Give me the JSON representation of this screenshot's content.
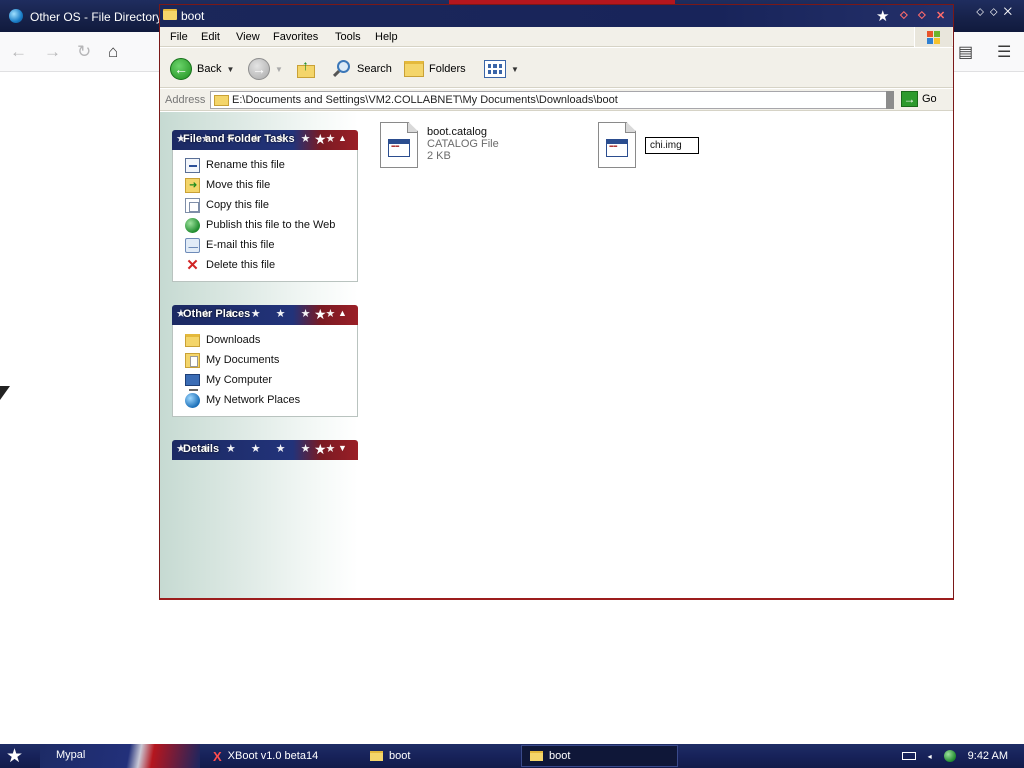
{
  "browser": {
    "title": "Other OS - File Directory"
  },
  "explorer": {
    "title": "boot",
    "menu": [
      "File",
      "Edit",
      "View",
      "Favorites",
      "Tools",
      "Help"
    ],
    "toolbar": {
      "back_label": "Back",
      "search_label": "Search",
      "folders_label": "Folders"
    },
    "address": {
      "label": "Address",
      "path": "E:\\Documents and Settings\\VM2.COLLABNET\\My Documents\\Downloads\\boot",
      "go_label": "Go"
    },
    "panels": {
      "file_tasks": {
        "title": "File and Folder Tasks",
        "items": [
          {
            "label": "Rename this file",
            "icon": "rename-icon"
          },
          {
            "label": "Move this file",
            "icon": "move-icon"
          },
          {
            "label": "Copy this file",
            "icon": "copy-icon"
          },
          {
            "label": "Publish this file to the Web",
            "icon": "publish-web-icon"
          },
          {
            "label": "E-mail this file",
            "icon": "email-icon"
          },
          {
            "label": "Delete this file",
            "icon": "delete-icon"
          }
        ]
      },
      "other_places": {
        "title": "Other Places",
        "items": [
          {
            "label": "Downloads",
            "icon": "folder-icon"
          },
          {
            "label": "My Documents",
            "icon": "my-documents-icon"
          },
          {
            "label": "My Computer",
            "icon": "my-computer-icon"
          },
          {
            "label": "My Network Places",
            "icon": "network-places-icon"
          }
        ]
      },
      "details": {
        "title": "Details"
      }
    },
    "files": [
      {
        "name": "boot.catalog",
        "type": "CATALOG File",
        "size": "2 KB"
      },
      {
        "rename_value": "chi.img"
      }
    ]
  },
  "taskbar": {
    "items": [
      {
        "label": "Mypal"
      },
      {
        "label": "XBoot v1.0 beta14"
      },
      {
        "label": "boot"
      },
      {
        "label": "boot"
      }
    ],
    "clock": "9:42 AM"
  },
  "colors": {
    "titlebar_navy": "#18245a",
    "flag_red": "#b5161e",
    "xp_toolbar": "#f2f0e9"
  }
}
